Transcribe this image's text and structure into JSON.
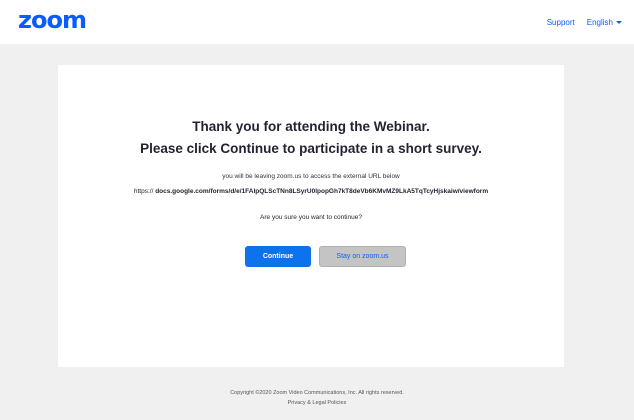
{
  "header": {
    "logo": "zoom",
    "support_label": "Support",
    "language_label": "English"
  },
  "card": {
    "title_line1": "Thank you for attending the Webinar.",
    "title_line2": "Please click Continue to participate in a short survey.",
    "leaving_note": "you will be leaving zoom.us to access the external URL below",
    "url_prefix": "https://",
    "url_rest": "docs.google.com/forms/d/e/1FAIpQLScTNn8LSyrU0lpopGh7kT8deVb6KMvMZ9LkA5TqTcyHjskaiw/viewform",
    "question": "Are you sure you want to continue?",
    "continue_label": "Continue",
    "stay_label": "Stay on zoom.us"
  },
  "footer": {
    "copyright": "Copyright ©2020 Zoom Video Communications, Inc. All rights reserved.",
    "policies_link": "Privacy & Legal Policies"
  },
  "colors": {
    "brand": "#0b5cff",
    "primary_button": "#0e72ed",
    "secondary_button": "#c4c4c4",
    "page_background": "#f0f0f0"
  }
}
